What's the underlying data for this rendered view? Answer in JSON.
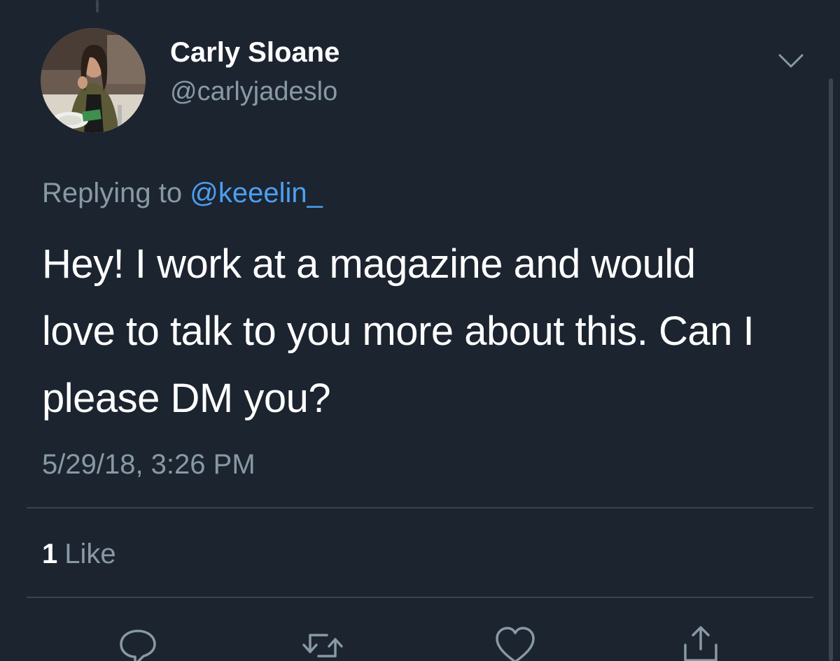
{
  "tweet": {
    "display_name": "Carly Sloane",
    "handle": "@carlyjadeslo",
    "replying_prefix": "Replying to",
    "replying_to": "@keeelin_",
    "text_lines": [
      "Hey! I work at a magazine and would",
      "love to talk to you more about this. Can I",
      "please DM you?"
    ],
    "timestamp": "5/29/18, 3:26 PM"
  },
  "stats": {
    "likes_count": "1",
    "likes_label": "Like"
  },
  "actions": [
    {
      "name": "reply",
      "icon": "speech-bubble-icon"
    },
    {
      "name": "retweet",
      "icon": "retweet-arrows-icon"
    },
    {
      "name": "like",
      "icon": "heart-icon"
    },
    {
      "name": "share",
      "icon": "share-upload-icon"
    }
  ],
  "icons": {
    "more_menu": "chevron-down-icon"
  },
  "colors": {
    "background": "#1c2430",
    "secondary_text": "#8899a6",
    "link": "#4c9ff1",
    "divider": "#38444d"
  }
}
